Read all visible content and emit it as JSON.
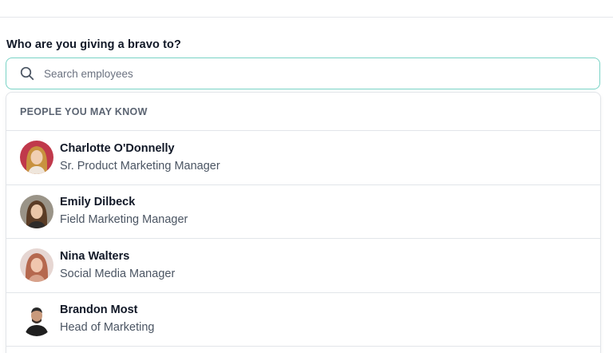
{
  "prompt": {
    "question": "Who are you giving a bravo to?"
  },
  "search": {
    "placeholder": "Search employees",
    "value": "",
    "icon": "search-icon",
    "border_color": "#79d3c6"
  },
  "suggestions": {
    "header": "PEOPLE YOU MAY KNOW",
    "people": [
      {
        "name": "Charlotte O'Donnelly",
        "title": "Sr. Product Marketing Manager"
      },
      {
        "name": "Emily Dilbeck",
        "title": "Field Marketing Manager"
      },
      {
        "name": "Nina Walters",
        "title": "Social Media Manager"
      },
      {
        "name": "Brandon Most",
        "title": "Head of Marketing"
      }
    ]
  }
}
